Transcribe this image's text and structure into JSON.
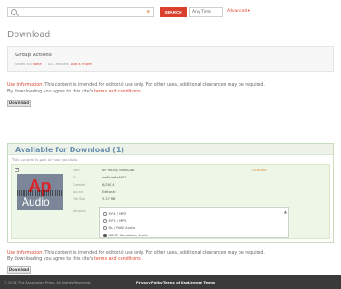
{
  "search": {
    "placeholder": "",
    "button_label": "SEARCH",
    "scope_value": "Any Time",
    "advanced_label": "Advanced ▾"
  },
  "page": {
    "title": "Download"
  },
  "group_actions": {
    "title": "Group Actions",
    "select_all": "Select All",
    "select_all_link": "None",
    "all_checked": "All Checked:",
    "all_checked_link": "Add a Share"
  },
  "usage_info": {
    "label": "Use Information:",
    "text": " This content is intended for editorial use only. For other uses, additional clearances may be required.",
    "line2_prefix": "By downloading you agree to this site's ",
    "terms_link": "terms and conditions",
    "line2_suffix": "."
  },
  "download_button_label": "Download",
  "available": {
    "title": "Available for Download (1)",
    "subtitle": "This content is part of your portfolio."
  },
  "item": {
    "logo_ap": "Ap",
    "logo_audio": "Audio",
    "status": "Licensed",
    "meta": [
      {
        "label": "Title",
        "value": "AP Hourly NewsCast"
      },
      {
        "label": "ID",
        "value": "ae6b4e6a6002"
      },
      {
        "label": "Created",
        "value": "6/28/14"
      },
      {
        "label": "Source",
        "value": "Editorial"
      },
      {
        "label": "File Size",
        "value": "3.27 MB"
      }
    ],
    "versions_label": "Versions",
    "versions": [
      {
        "label": "MP4 / MP3",
        "selected": false
      },
      {
        "label": "MP3 / MP3",
        "selected": false
      },
      {
        "label": "RA / RAW Audio",
        "selected": false
      },
      {
        "label": "WAVE Waveform Audio",
        "selected": true
      }
    ]
  },
  "footer": {
    "copyright": "© 2014 The Associated Press. All Rights Reserved.",
    "links": [
      "Privacy Policy",
      "Terms of Use",
      "License Terms"
    ]
  },
  "colors": {
    "accent": "#d9412c",
    "footer_bg": "#3a3a3a",
    "item_bg": "#eef7e7"
  }
}
